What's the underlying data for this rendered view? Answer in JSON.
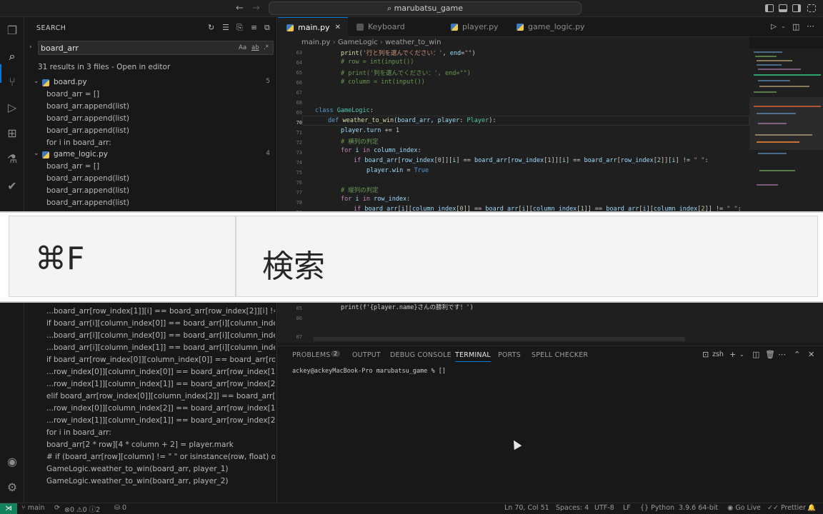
{
  "titlebar": {
    "back_icon": "arrow-left-icon",
    "forward_icon": "arrow-right-icon",
    "search_text": "marubatsu_game"
  },
  "sidebar": {
    "title": "SEARCH",
    "search_value": "board_arr",
    "options": [
      "Aa",
      "ab",
      ".*"
    ],
    "summary": "31 results in 3 files - Open in editor",
    "files": [
      {
        "name": "board.py",
        "count": "5"
      },
      {
        "name": "game_logic.py",
        "count": "4"
      }
    ],
    "matches_top": [
      "board_arr = []",
      "board_arr.append(list)",
      "board_arr.append(list)",
      "board_arr.append(list)",
      "for i in board_arr:",
      "board_arr = []",
      "board_arr.append(list)",
      "board_arr.append(list)",
      "board_arr.append(list)"
    ],
    "matches_bottom": [
      "...board_arr[row_index[1]][i] == board_arr[row_index[2]][i] != \" \":",
      "if board_arr[i][column_index[0]] == board_arr[i][column_index[1]] ==...",
      "...board_arr[i][column_index[0]] == board_arr[i][column_index[1]] ==...",
      "...board_arr[i][column_index[1]] == board_arr[i][column_index[2]] !=...",
      "if board_arr[row_index[0]][column_index[0]] == board_arr[row_inde...",
      "...row_index[0]][column_index[0]] == board_arr[row_index[1]][colum...",
      "...row_index[1]][column_index[1]] == board_arr[row_index[2]][colum...",
      "elif board_arr[row_index[0]][column_index[2]] == board_arr[row_ind...",
      "...row_index[0]][column_index[2]] == board_arr[row_index[1]][colum...",
      "...row_index[1]][column_index[1]] == board_arr[row_index[2]][colum...",
      "for i in board_arr:",
      "board_arr[2 * row][4 * column + 2] = player.mark",
      "# if (board_arr[row][column] != \" \" or isinstance(row, float) or isinstan...",
      "GameLogic.weather_to_win(board_arr, player_1)",
      "GameLogic.weather_to_win(board_arr, player_2)"
    ]
  },
  "tabs": [
    {
      "label": "main.py"
    },
    {
      "label": "Keyboard Shortcuts"
    },
    {
      "label": "player.py"
    },
    {
      "label": "game_logic.py"
    }
  ],
  "breadcrumbs": [
    "main.py",
    "GameLogic",
    "weather_to_win"
  ],
  "editor": {
    "line_numbers": [
      "63",
      "64",
      "65",
      "66",
      "67",
      "68",
      "69",
      "70",
      "71",
      "72",
      "73",
      "74",
      "75",
      "76",
      "77",
      "78",
      "79",
      "85",
      "86",
      "87"
    ],
    "bottom_code": "print(f'{player.name}さんの勝利です！')"
  },
  "overlay": {
    "key": "⌘F",
    "label": "検索"
  },
  "panel": {
    "tabs": [
      "PROBLEMS",
      "OUTPUT",
      "DEBUG CONSOLE",
      "TERMINAL",
      "PORTS",
      "SPELL CHECKER"
    ],
    "problems_count": "2",
    "shell": "zsh",
    "terminal_line": "ackey@ackeyMacBook-Pro marubatsu_game % []"
  },
  "statusbar": {
    "branch": "main",
    "errors": "0",
    "warnings": "0",
    "infos": "2",
    "ports": "0",
    "position": "Ln 70, Col 51",
    "spaces": "Spaces: 4",
    "encoding": "UTF-8",
    "eol": "LF",
    "language": "Python",
    "interpreter": "3.9.6 64-bit",
    "golive": "Go Live",
    "prettier": "Prettier"
  },
  "accounts_badge": "1"
}
